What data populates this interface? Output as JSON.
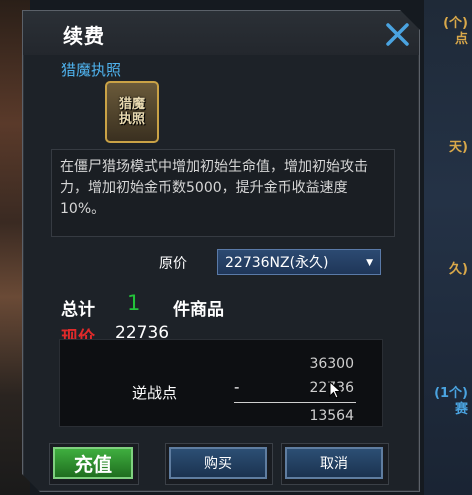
{
  "background": {
    "tags": [
      "(个)",
      "点",
      "天)",
      "久)",
      "(1个)",
      "赛"
    ]
  },
  "dialog": {
    "title": "续费",
    "item": {
      "name": "猎魔执照",
      "icon_text": [
        "猎魔",
        "执照"
      ]
    },
    "description": "在僵尸猎场模式中增加初始生命值，增加初始攻击力，增加初始金币数5000，提升金币收益速度10%。",
    "original_price_label": "原价",
    "price_option": "22736NZ(永久)",
    "total_label": "总计",
    "total_count": "1",
    "total_suffix": "件商品",
    "current_price_label": "现价",
    "current_price": "22736",
    "calc": {
      "label": "逆战点",
      "balance": "36300",
      "minus": "-",
      "cost": "22736",
      "remaining": "13564"
    },
    "buttons": {
      "recharge": "充值",
      "buy": "购买",
      "cancel": "取消"
    }
  },
  "colors": {
    "item_name": "#4fb3ee",
    "count_green": "#23c23a",
    "price_red": "#e02a2a",
    "close_icon": "#4aa3e0"
  },
  "icons": {
    "close": "close-icon",
    "dropdown": "triangle-down-icon",
    "cursor": "mouse-cursor-icon"
  }
}
